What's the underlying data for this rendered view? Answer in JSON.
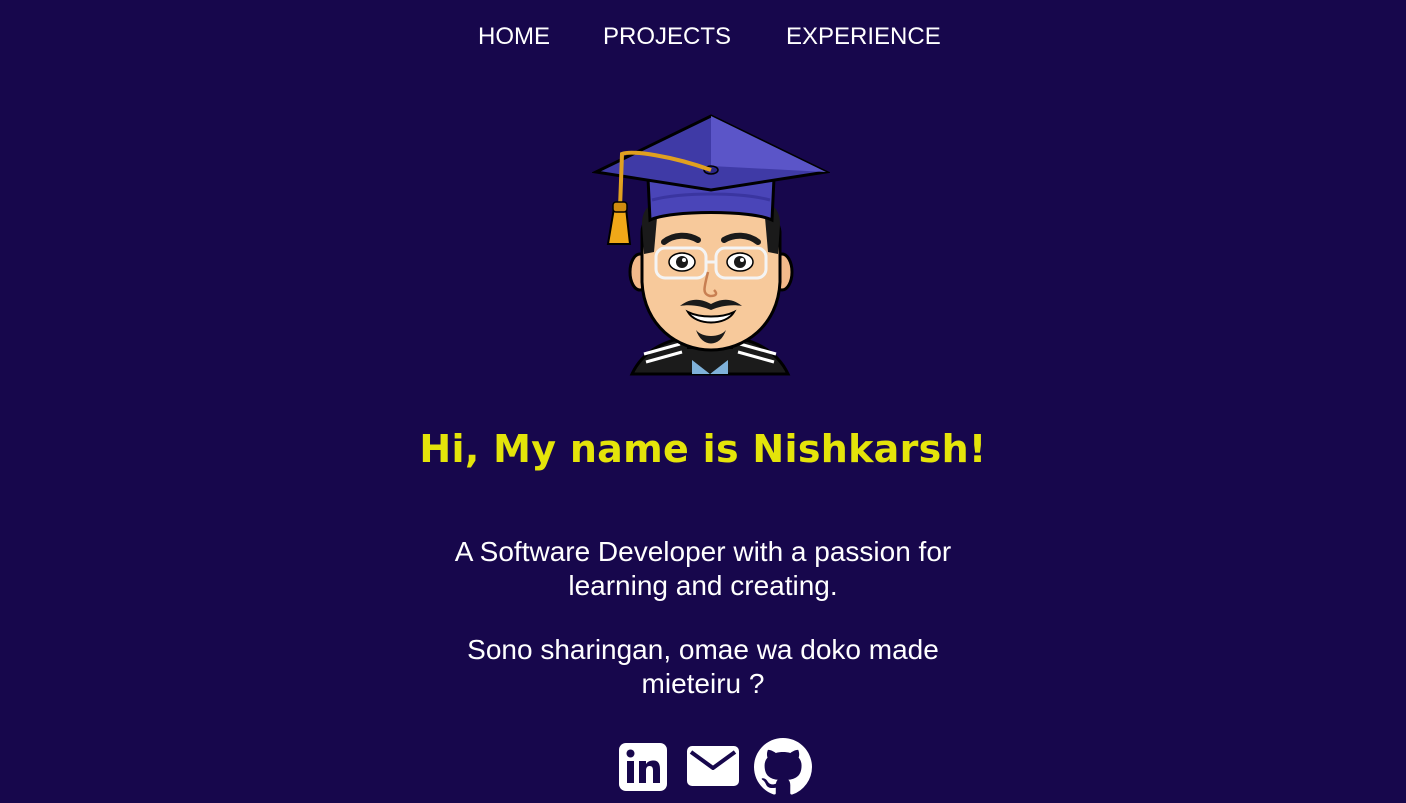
{
  "nav": {
    "items": [
      {
        "label": "HOME"
      },
      {
        "label": "PROJECTS"
      },
      {
        "label": "EXPERIENCE"
      }
    ]
  },
  "hero": {
    "headline": "Hi, My name is Nishkarsh!",
    "tagline_lines": [
      "A Software Developer with a passion for",
      "learning and creating."
    ],
    "quote_lines": [
      "Sono sharingan, omae wa doko made",
      "mieteiru ?"
    ]
  },
  "social": {
    "icons": [
      "linkedin-icon",
      "mail-icon",
      "github-icon"
    ]
  },
  "colors": {
    "background": "#17074c",
    "headline": "#e4e40a",
    "text": "#ffffff"
  }
}
